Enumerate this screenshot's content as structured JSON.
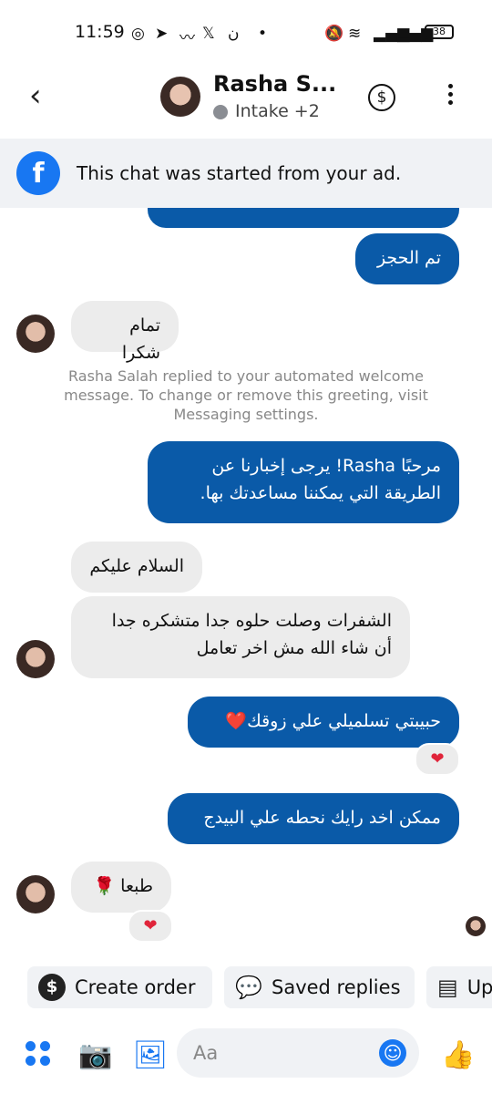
{
  "status_bar": {
    "time": "11:59",
    "battery": "38",
    "icons": [
      "whatsapp-icon",
      "telegram-icon",
      "signal-icon",
      "x-icon",
      "app-icon",
      "dot",
      "mute-icon",
      "wifi-icon",
      "cell-signal-icon",
      "cell-signal-icon"
    ]
  },
  "header": {
    "back_icon": "‹",
    "name": "Rasha S...",
    "status_label": "Intake +2",
    "dollar_icon": "$"
  },
  "ad_banner": {
    "icon": "f",
    "text": "This chat was started from your ad."
  },
  "messages": {
    "m0": {
      "text": ""
    },
    "m1": {
      "text": "تم الحجز"
    },
    "m2": {
      "text": "تمام شكرا"
    },
    "system_note": "Rasha Salah replied to your automated welcome message. To change or remove this greeting, visit Messaging settings.",
    "m3": {
      "text": "مرحبًا Rasha! يرجى إخبارنا عن الطريقة التي يمكننا مساعدتك بها."
    },
    "m4": {
      "text": "السلام عليكم"
    },
    "m5": {
      "text": "الشفرات وصلت حلوه جدا متشكره جدا أن شاء الله مش اخر تعامل"
    },
    "m6": {
      "text": "حبيبتي تسلميلي علي زوقك❤️",
      "reaction": "❤"
    },
    "m7": {
      "text": "ممكن اخد رايك نحطه علي البيدج"
    },
    "m8": {
      "text": "طبعا 🌹",
      "reaction": "❤"
    }
  },
  "quick_replies": {
    "create_order": "Create order",
    "saved_replies": "Saved replies",
    "third": "Up"
  },
  "composer": {
    "placeholder": "Aa"
  },
  "colors": {
    "outgoing_bubble": "#0a5aa8",
    "incoming_bubble": "#ececec",
    "accent": "#1877f2"
  }
}
